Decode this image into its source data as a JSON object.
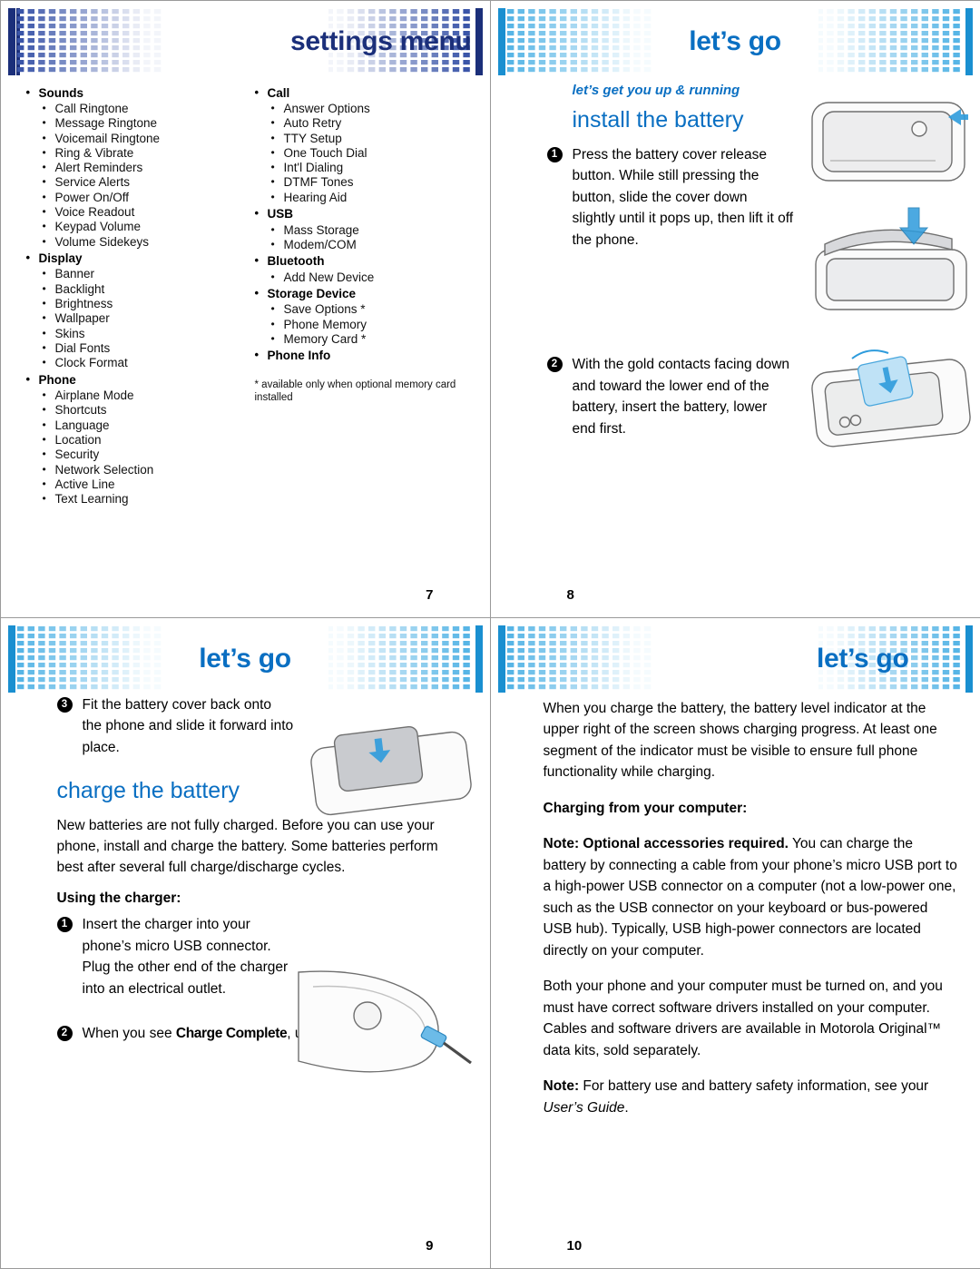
{
  "pages": {
    "p7": {
      "banner_title": "settings menu",
      "page_number": "7",
      "columns": [
        {
          "groups": [
            {
              "title": "Sounds",
              "items": [
                "Call Ringtone",
                "Message Ringtone",
                "Voicemail Ringtone",
                "Ring & Vibrate",
                "Alert Reminders",
                "Service Alerts",
                "Power On/Off",
                "Voice Readout",
                "Keypad Volume",
                "Volume Sidekeys"
              ]
            },
            {
              "title": "Display",
              "items": [
                "Banner",
                "Backlight",
                "Brightness",
                "Wallpaper",
                "Skins",
                "Dial Fonts",
                "Clock Format"
              ]
            },
            {
              "title": "Phone",
              "items": [
                "Airplane Mode",
                "Shortcuts",
                "Language",
                "Location",
                "Security",
                "Network Selection",
                "Active Line",
                "Text Learning"
              ]
            }
          ]
        },
        {
          "groups": [
            {
              "title": "Call",
              "items": [
                "Answer Options",
                "Auto Retry",
                "TTY Setup",
                "One Touch Dial",
                "Int'l Dialing",
                "DTMF Tones",
                "Hearing Aid"
              ]
            },
            {
              "title": "USB",
              "items": [
                "Mass Storage",
                "Modem/COM"
              ]
            },
            {
              "title": "Bluetooth",
              "items": [
                "Add New Device"
              ]
            },
            {
              "title": "Storage Device",
              "items": [
                "Save Options *",
                "Phone Memory",
                "Memory Card *"
              ]
            },
            {
              "title": "Phone Info",
              "items": []
            }
          ],
          "footnote": "* available only when optional memory card installed"
        }
      ]
    },
    "p8": {
      "banner_title": "let’s go",
      "kicker": "let’s get you up & running",
      "heading": "install the battery",
      "page_number": "8",
      "steps": [
        {
          "num": "❶",
          "text": "Press the battery cover release button. While still pressing the button, slide the cover down slightly until it pops up, then lift it off the phone."
        },
        {
          "num": "❷",
          "text": "With the gold contacts facing down and toward the lower end of the battery, insert the battery, lower end first."
        }
      ]
    },
    "p9": {
      "banner_title": "let’s go",
      "page_number": "9",
      "step3": {
        "num": "❸",
        "text": "Fit the battery cover back onto the phone and slide it forward into place."
      },
      "heading": "charge the battery",
      "intro": "New batteries are not fully charged. Before you can use your phone, install and charge the battery. Some batteries perform best after several full charge/discharge cycles.",
      "subhead": "Using the charger:",
      "step1": {
        "num": "❶",
        "text": "Insert the charger into your phone’s micro USB connector. Plug the other end of the charger into an electrical outlet."
      },
      "step2": {
        "num": "❷",
        "prefix": "When you see ",
        "emphasis": "Charge Complete",
        "suffix": ", unplug the charger."
      }
    },
    "p10": {
      "banner_title": "let’s go",
      "page_number": "10",
      "paragraphs": [
        {
          "style": "normal",
          "text": "When you charge the battery, the battery level indicator at the upper right of the screen shows charging progress. At least one segment of the indicator must be visible to ensure full phone functionality while charging."
        },
        {
          "style": "bold",
          "text": "Charging from your computer:"
        },
        {
          "style": "mixed_note",
          "bold_part": "Note: Optional accessories required.",
          "rest": " You can charge the battery by connecting a cable from your phone’s micro USB port to a high-power USB connector on a computer (not a low-power one, such as the USB connector on your keyboard or bus-powered USB hub). Typically, USB high-power connectors are located directly on your computer."
        },
        {
          "style": "normal",
          "text": "Both your phone and your computer must be turned on, and you must have correct software drivers installed on your computer. Cables and software drivers are available in Motorola Original™ data kits, sold separately."
        },
        {
          "style": "note_italic",
          "bold_part": "Note:",
          "rest": " For battery use and battery safety information, see your ",
          "italic_part": "User’s Guide",
          "tail": "."
        }
      ]
    }
  },
  "colors": {
    "navy": "#1b2f7a",
    "blue": "#0a6fc2",
    "light_blue": "#7fc4ee",
    "mid_blue": "#2d9bdc"
  },
  "icons": {
    "bullet": "•",
    "step1": "❶",
    "step2": "❷",
    "step3": "❸"
  }
}
